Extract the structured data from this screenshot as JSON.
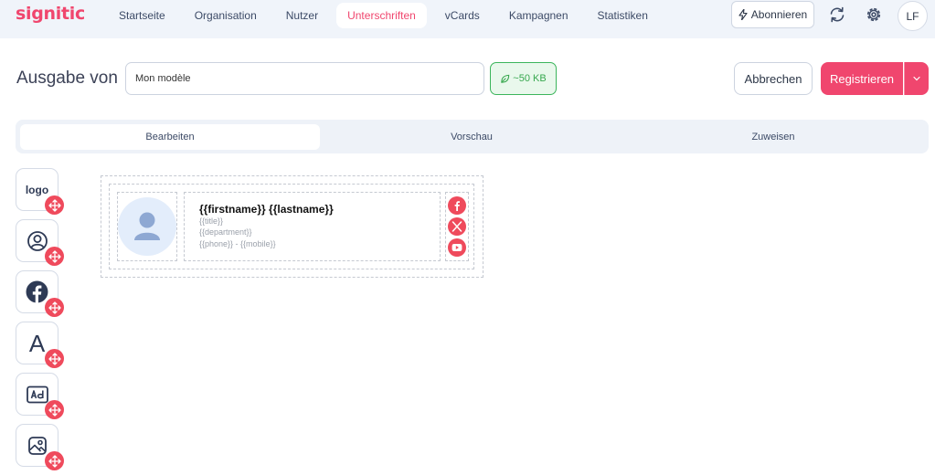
{
  "app": {
    "logo_text": "signitic"
  },
  "nav": {
    "items": [
      {
        "label": "Startseite"
      },
      {
        "label": "Organisation"
      },
      {
        "label": "Nutzer"
      },
      {
        "label": "Unterschriften"
      },
      {
        "label": "vCards"
      },
      {
        "label": "Kampagnen"
      },
      {
        "label": "Statistiken"
      }
    ],
    "active_index": 3,
    "subscribe_label": "Abonnieren",
    "refresh_icon": "refresh-icon",
    "settings_icon": "gear-icon",
    "user_initials": "LF"
  },
  "editor": {
    "title": "Ausgabe von",
    "name_value": "Mon modèle",
    "size_label": "~50 KB",
    "cancel_label": "Abbrechen",
    "register_label": "Registrieren"
  },
  "tabs": [
    {
      "label": "Bearbeiten"
    },
    {
      "label": "Vorschau"
    },
    {
      "label": "Zuweisen"
    }
  ],
  "active_tab": 0,
  "tools": [
    {
      "label": "logo",
      "icon": "logo-text"
    },
    {
      "icon": "user-circle-icon"
    },
    {
      "icon": "facebook-icon"
    },
    {
      "label": "A",
      "icon": "font-icon"
    },
    {
      "icon": "ad-icon"
    },
    {
      "icon": "image-icon"
    }
  ],
  "signature": {
    "name": "{{firstname}} {{lastname}}",
    "title": "{{title}}",
    "department": "{{department}}",
    "phone": "{{phone}} - {{mobile}}",
    "socials": [
      "facebook-icon",
      "x-icon",
      "youtube-icon"
    ]
  },
  "colors": {
    "brand": "#f0466e",
    "social": "#ef4a5c",
    "size_badge": "#38a84f",
    "background_bar": "#f0f4fa"
  }
}
